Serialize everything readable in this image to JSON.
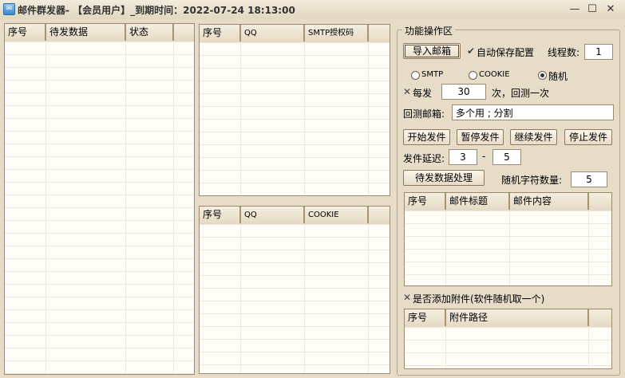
{
  "window": {
    "title": "邮件群发器- 【会员用户】_到期时间：2022-07-24 18:13:00",
    "icon": "envelope-app-icon",
    "min_glyph": "—",
    "max_glyph": "☐",
    "close_glyph": "✕"
  },
  "left_table": {
    "columns": [
      "序号",
      "待发数据",
      "状态"
    ]
  },
  "smtp_table": {
    "columns": [
      "序号",
      "QQ",
      "SMTP授权码"
    ]
  },
  "cookie_table": {
    "columns": [
      "序号",
      "QQ",
      "COOKIE"
    ]
  },
  "ops": {
    "group_title": "功能操作区",
    "import_button": "导入邮箱",
    "autosave_check": "✔",
    "autosave_label": "自动保存配置",
    "threads_label": "线程数:",
    "threads_value": "1",
    "radio_smtp": "SMTP",
    "radio_cookie": "COOKIE",
    "radio_random": "随机",
    "every_check": "✕",
    "every_label": "每发",
    "every_value": "30",
    "every_suffix": "次，回测一次",
    "test_mail_label": "回测邮箱:",
    "test_mail_value": "多个用 ; 分割",
    "start_button": "开始发件",
    "pause_button": "暂停发件",
    "resume_button": "继续发件",
    "stop_button": "停止发件",
    "delay_label": "发件延迟:",
    "delay_min": "3",
    "delay_sep": "-",
    "delay_max": "5",
    "process_button": "待发数据处理",
    "random_chars_label": "随机字符数量:",
    "random_chars_value": "5",
    "attach_check": "✕",
    "attach_label": "是否添加附件(软件随机取一个)"
  },
  "mail_table": {
    "columns": [
      "序号",
      "邮件标题",
      "邮件内容"
    ]
  },
  "attach_table": {
    "columns": [
      "序号",
      "附件路径"
    ]
  }
}
